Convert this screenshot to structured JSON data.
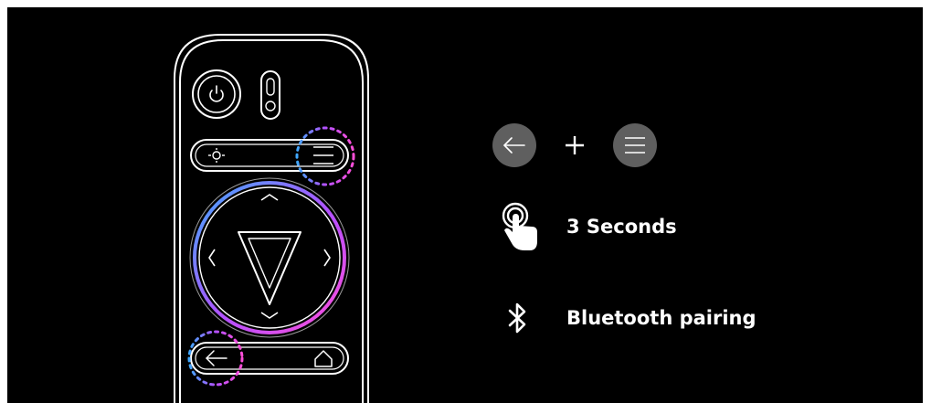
{
  "colors": {
    "background": "#000000",
    "remote_outline": "#ffffff",
    "button_fill": "#5f5f5f",
    "ring_gradient": [
      "#3fa9ff",
      "#c848ff",
      "#ff4fd8"
    ],
    "highlight_dots": [
      "#3fa9ff",
      "#b450ff",
      "#ff4fd8"
    ]
  },
  "icons": {
    "back": "arrow-left-icon",
    "menu": "menu-lines-icon",
    "plus": "plus-icon",
    "press": "finger-press-icon",
    "bluetooth": "bluetooth-icon",
    "power": "power-icon",
    "home": "home-icon",
    "sun": "brightness-icon"
  },
  "instructions": {
    "hold_label": "3 Seconds",
    "bt_label": "Bluetooth pairing"
  }
}
